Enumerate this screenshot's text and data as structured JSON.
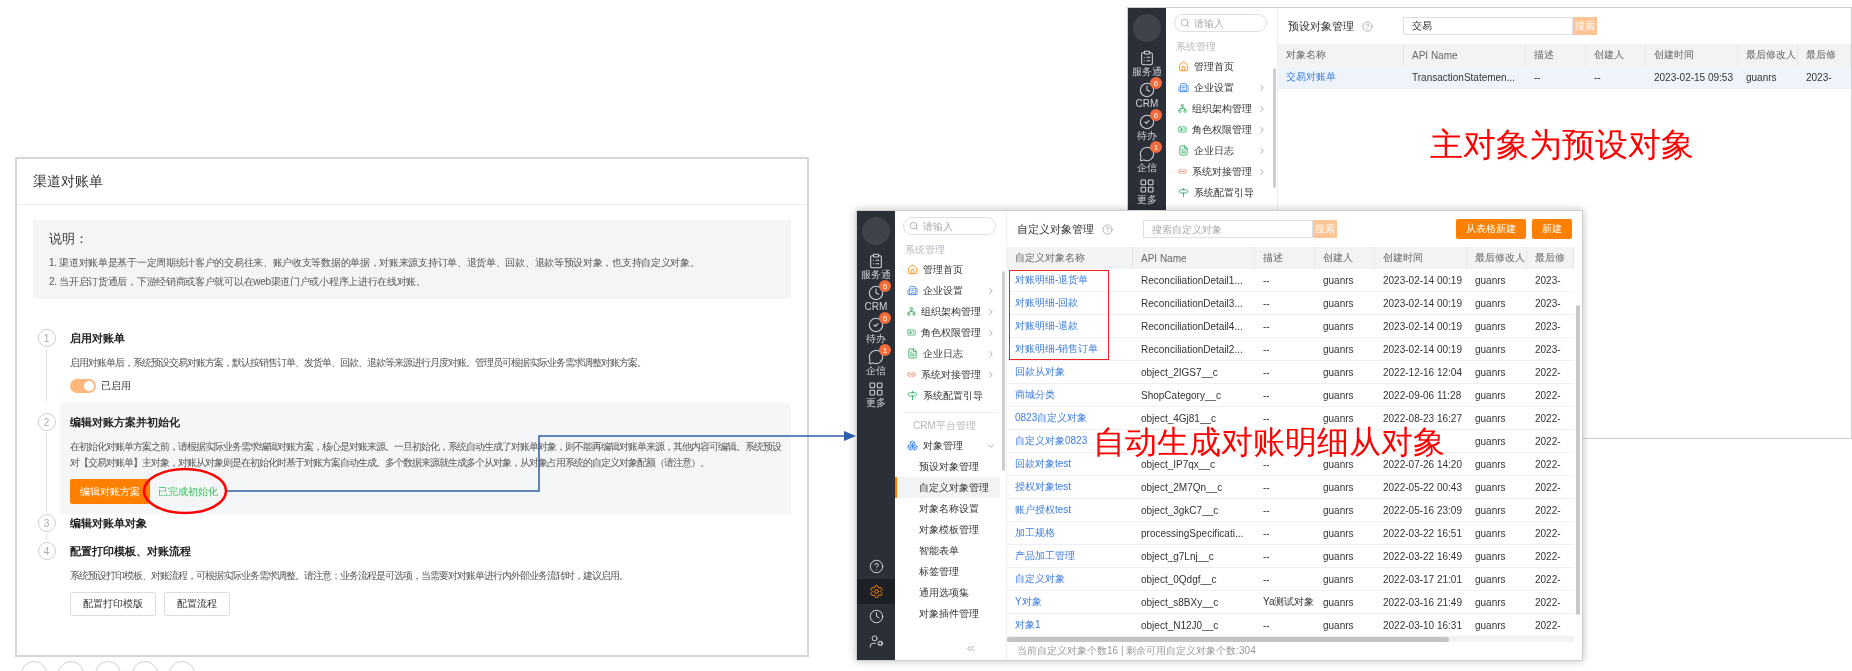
{
  "reconciliation_page": {
    "title": "渠道对账单",
    "notice": {
      "heading": "说明：",
      "lines": [
        "1. 渠道对账单是基于一定周期统计客户的交易往来、账户收支等数据的单据，对账来源支持订单、退货单、回款、退款等预设对象，也支持自定义对象。",
        "2. 当开启订货通后，下游经销商或客户就可以在web渠道门户或小程序上进行在线对账。"
      ]
    },
    "steps": [
      {
        "number": "1",
        "title": "启用对账单",
        "active": false,
        "description": "启用对账单后，系统预设交易对账方案，默认按销售订单、发货单、回款、退款等来源进行月度对账。管理员可根据实际业务需求调整对账方案。",
        "toggle": {
          "on": true,
          "label": "已启用"
        }
      },
      {
        "number": "2",
        "title": "编辑对账方案并初始化",
        "active": true,
        "description": "在初始化对账单方案之前，请根据实际业务需求编辑对账方案，核心是对账来源。一旦初始化，系统自动生成了对账单对象，则不能再编辑对账单来源，其他内容可编辑。系统预设对【交易对账单】主对象，对账从对象则是在初始化时基于对账方案自动生成。多个数据来源就生成多个从对象，从对象占用系统的自定义对象配额（请注意）。",
        "primary_button": "编辑对账方案",
        "status": "已完成初始化"
      },
      {
        "number": "3",
        "title": "编辑对账单对象",
        "active": false
      },
      {
        "number": "4",
        "title": "配置打印模板、对账流程",
        "active": false,
        "description": "系统预设打印模板、对账流程，可根据实际业务需求调整。请注意：业务流程是可选项，当需要对对账单进行内外部业务流转时，建议启用。",
        "buttons": [
          "配置打印模版",
          "配置流程"
        ]
      }
    ]
  },
  "preset_objects_screen": {
    "rail": {
      "items": [
        {
          "label": "服务通"
        },
        {
          "label": "CRM",
          "badge": "6"
        },
        {
          "label": "待办",
          "badge": "6"
        },
        {
          "label": "企信",
          "badge": "1"
        },
        {
          "label": "更多"
        }
      ]
    },
    "sidebar": {
      "search_placeholder": "请输入",
      "sections": [
        {
          "title": "系统管理",
          "items": [
            {
              "label": "管理首页"
            },
            {
              "label": "企业设置",
              "expanded": false
            },
            {
              "label": "组织架构管理",
              "expanded": false
            },
            {
              "label": "角色权限管理",
              "expanded": false
            },
            {
              "label": "企业日志",
              "expanded": false
            },
            {
              "label": "系统对接管理",
              "expanded": false
            },
            {
              "label": "系统配置引导"
            }
          ]
        }
      ]
    },
    "title": "预设对象管理",
    "search": {
      "value": "交易",
      "button": "搜索"
    },
    "table": {
      "columns": [
        "对象名称",
        "API Name",
        "描述",
        "创建人",
        "创建时间",
        "最后修改人",
        "最后修"
      ],
      "rows": [
        {
          "selected": true,
          "cells": [
            "交易对账单",
            "TransactionStatemen...",
            "--",
            "--",
            "2023-02-15 09:53",
            "guanrs",
            "2023-"
          ]
        }
      ]
    },
    "annotation": "主对象为预设对象"
  },
  "custom_objects_screen": {
    "rail": {
      "items": [
        {
          "label": "服务通"
        },
        {
          "label": "CRM",
          "badge": "6"
        },
        {
          "label": "待办",
          "badge": "6"
        },
        {
          "label": "企信",
          "badge": "1"
        },
        {
          "label": "更多"
        }
      ],
      "bottom_items": [
        {
          "selected": false
        },
        {
          "selected": true
        },
        {
          "selected": false
        },
        {
          "selected": false
        }
      ]
    },
    "sidebar": {
      "search_placeholder": "请输入",
      "collapse": true,
      "sections": [
        {
          "title": "系统管理",
          "items": [
            {
              "label": "管理首页"
            },
            {
              "label": "企业设置",
              "expanded": false
            },
            {
              "label": "组织架构管理",
              "expanded": false
            },
            {
              "label": "角色权限管理",
              "expanded": false
            },
            {
              "label": "企业日志",
              "expanded": false
            },
            {
              "label": "系统对接管理",
              "expanded": false
            },
            {
              "label": "系统配置引导"
            }
          ]
        },
        {
          "title": "CRM平台管理",
          "items": [
            {
              "label": "对象管理",
              "expanded": true,
              "children": [
                {
                  "label": "预设对象管理",
                  "selected": false
                },
                {
                  "label": "自定义对象管理",
                  "selected": true
                },
                {
                  "label": "对象名称设置",
                  "selected": false
                },
                {
                  "label": "对象模板管理",
                  "selected": false
                },
                {
                  "label": "智能表单",
                  "selected": false
                },
                {
                  "label": "标签管理",
                  "selected": false
                },
                {
                  "label": "通用选项集",
                  "selected": false
                },
                {
                  "label": "对象插件管理",
                  "selected": false
                }
              ]
            }
          ]
        }
      ]
    },
    "title": "自定义对象管理",
    "search": {
      "placeholder": "搜索自定义对象",
      "button": "搜索"
    },
    "actions": [
      "从表格新建",
      "新建"
    ],
    "table": {
      "columns": [
        "自定义对象名称",
        "API Name",
        "描述",
        "创建人",
        "创建时间",
        "最后修改人",
        "最后修"
      ],
      "rows": [
        {
          "highlighted": true,
          "cells": [
            "对账明细-退货单",
            "ReconciliationDetail1...",
            "--",
            "guanrs",
            "2023-02-14 00:19",
            "guanrs",
            "2023-"
          ]
        },
        {
          "highlighted": true,
          "cells": [
            "对账明细-回款",
            "ReconciliationDetail3...",
            "--",
            "guanrs",
            "2023-02-14 00:19",
            "guanrs",
            "2023-"
          ]
        },
        {
          "highlighted": true,
          "cells": [
            "对账明细-退款",
            "ReconciliationDetail4...",
            "--",
            "guanrs",
            "2023-02-14 00:19",
            "guanrs",
            "2023-"
          ]
        },
        {
          "highlighted": true,
          "cells": [
            "对账明细-销售订单",
            "ReconciliationDetail2...",
            "--",
            "guanrs",
            "2023-02-14 00:19",
            "guanrs",
            "2023-"
          ]
        },
        {
          "highlighted": false,
          "cells": [
            "回款从对象",
            "object_2IGS7__c",
            "--",
            "guanrs",
            "2022-12-16 12:04",
            "guanrs",
            "2022-"
          ]
        },
        {
          "highlighted": false,
          "cells": [
            "商城分类",
            "ShopCategory__c",
            "--",
            "guanrs",
            "2022-09-06 11:28",
            "guanrs",
            "2022-"
          ]
        },
        {
          "highlighted": false,
          "cells": [
            "0823自定义对象",
            "object_4Gj81__c",
            "--",
            "guanrs",
            "2022-08-23 16:27",
            "guanrs",
            "2022-"
          ]
        },
        {
          "highlighted": false,
          "cells": [
            "自定义对象0823",
            null,
            null,
            null,
            null,
            "guanrs",
            "2022-"
          ]
        },
        {
          "highlighted": false,
          "cells": [
            "回款对象test",
            "object_IP7qx__c",
            "--",
            "guanrs",
            "2022-07-26 14:20",
            "guanrs",
            "2022-"
          ]
        },
        {
          "highlighted": false,
          "cells": [
            "授权对象test",
            "object_2M7Qn__c",
            "--",
            "guanrs",
            "2022-05-22 00:43",
            "guanrs",
            "2022-"
          ]
        },
        {
          "highlighted": false,
          "cells": [
            "账户授权test",
            "object_3gkC7__c",
            "--",
            "guanrs",
            "2022-05-16 23:09",
            "guanrs",
            "2022-"
          ]
        },
        {
          "highlighted": false,
          "cells": [
            "加工规格",
            "processingSpecificati...",
            "--",
            "guanrs",
            "2022-03-22 16:51",
            "guanrs",
            "2022-"
          ]
        },
        {
          "highlighted": false,
          "cells": [
            "产品加工管理",
            "object_g7Lnj__c",
            "--",
            "guanrs",
            "2022-03-22 16:49",
            "guanrs",
            "2022-"
          ]
        },
        {
          "highlighted": false,
          "cells": [
            "自定义对象",
            "object_0Qdgf__c",
            "--",
            "guanrs",
            "2022-03-17 21:01",
            "guanrs",
            "2022-"
          ]
        },
        {
          "highlighted": false,
          "cells": [
            "Y对象",
            "object_s8BXy__c",
            "Ya测试对象",
            "guanrs",
            "2022-03-16 21:49",
            "guanrs",
            "2022-"
          ]
        },
        {
          "highlighted": false,
          "cells": [
            "对象1",
            "object_N12J0__c",
            "--",
            "guanrs",
            "2022-03-10 16:31",
            "guanrs",
            "2022-"
          ]
        }
      ]
    },
    "footer": "当前自定义对象个数16 | 剩余可用自定义对象个数:304",
    "annotation": "自动生成对账明细从对象"
  }
}
